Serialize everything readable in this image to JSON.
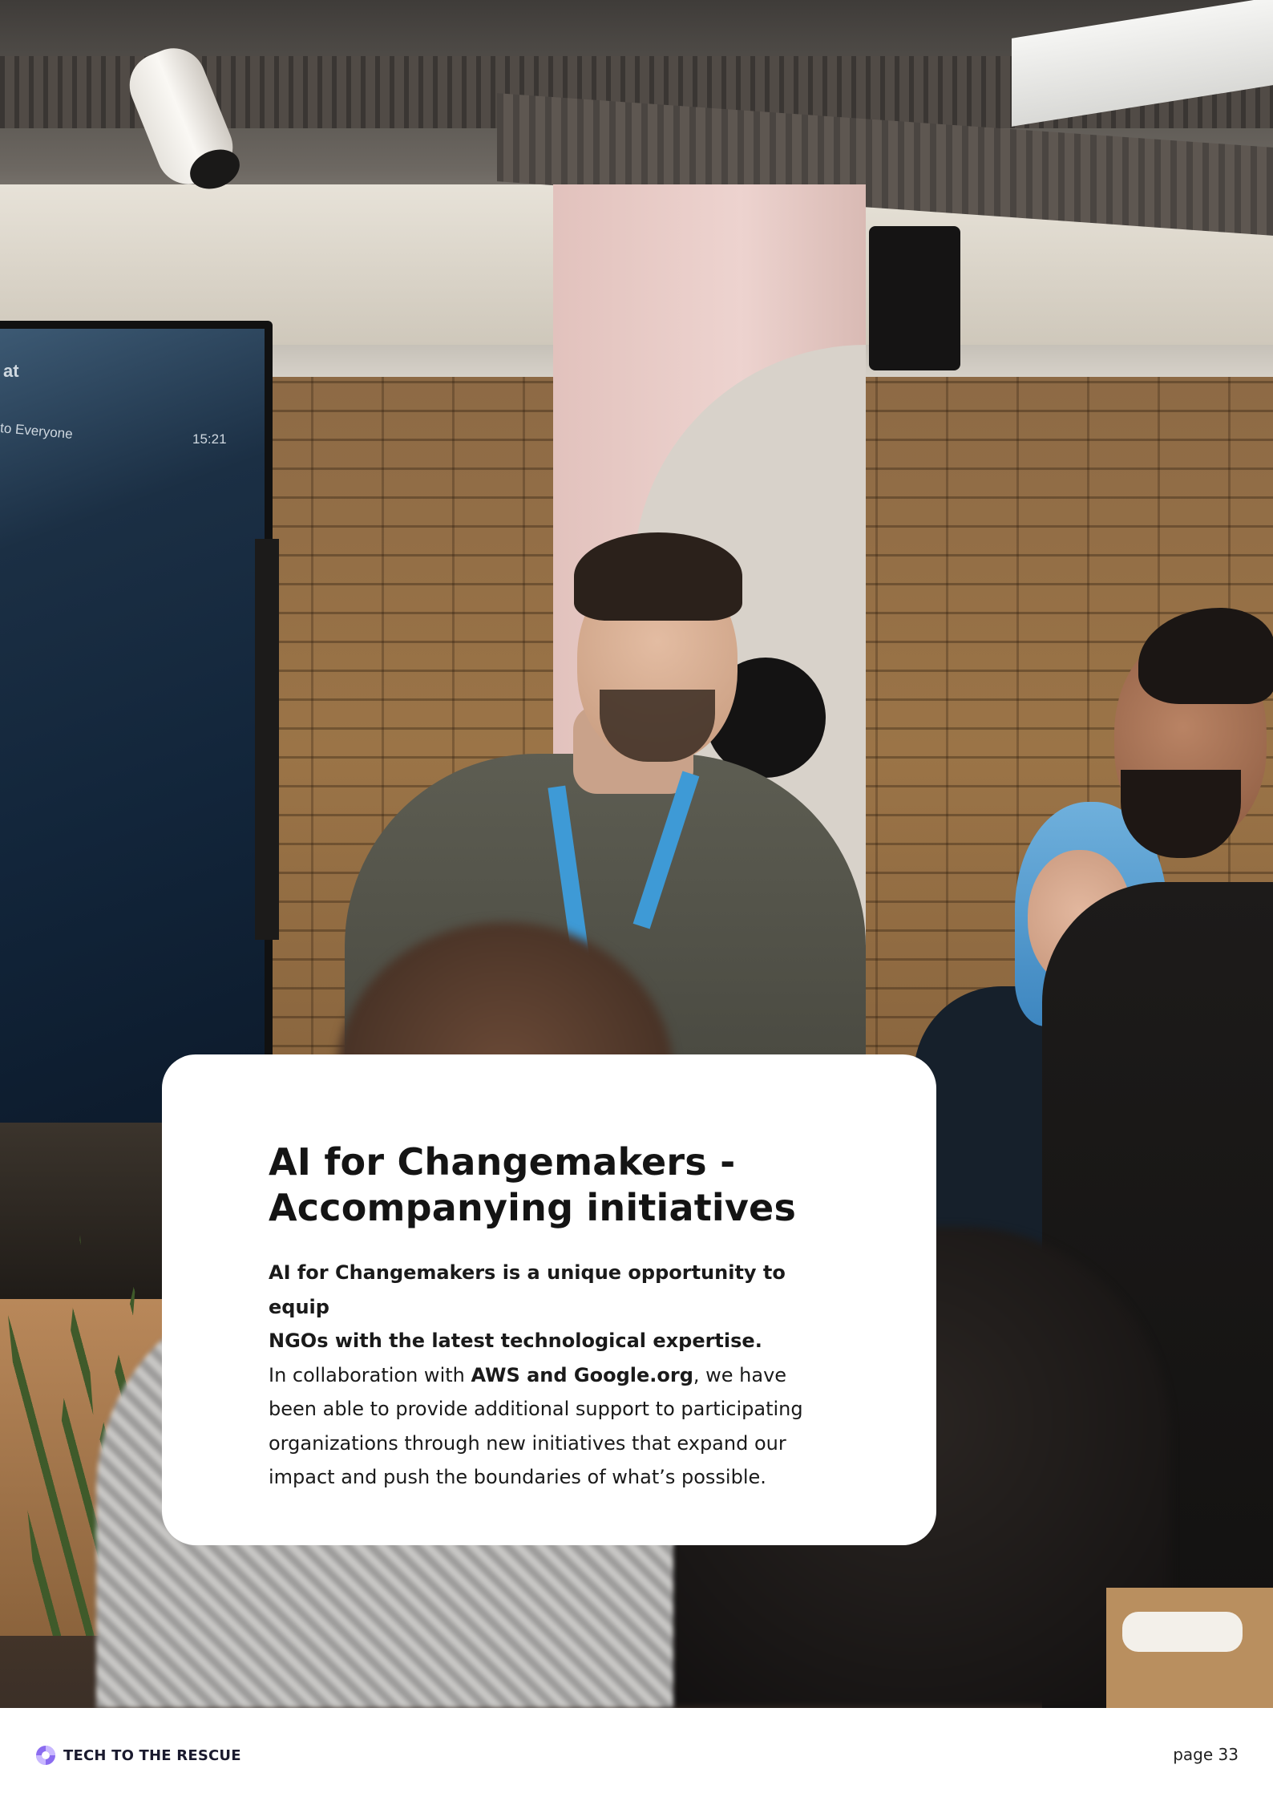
{
  "photo": {
    "screen_text_1": "at",
    "screen_text_2": "to Everyone",
    "screen_time": "15:21"
  },
  "card": {
    "title_line_1": "AI for Changemakers -",
    "title_line_2": "Accompanying initiatives",
    "lead_line_1": "AI for Changemakers is a unique opportunity to equip",
    "lead_line_2": "NGOs with the latest technological expertise.",
    "body_prefix": "In collaboration with ",
    "body_bold": "AWS and Google.org",
    "body_suffix": ", we have",
    "body_line_2": "been able to provide additional support to participating",
    "body_line_3": "organizations through new initiatives that expand our",
    "body_line_4": "impact and push the boundaries of what’s possible."
  },
  "footer": {
    "brand": "TECH TO THE RESCUE",
    "logo_icon": "lifebuoy-icon",
    "page_label": "page 33"
  },
  "colors": {
    "brand_purple": "#8b6cf0",
    "text_dark": "#141414",
    "card_bg": "#ffffff"
  }
}
